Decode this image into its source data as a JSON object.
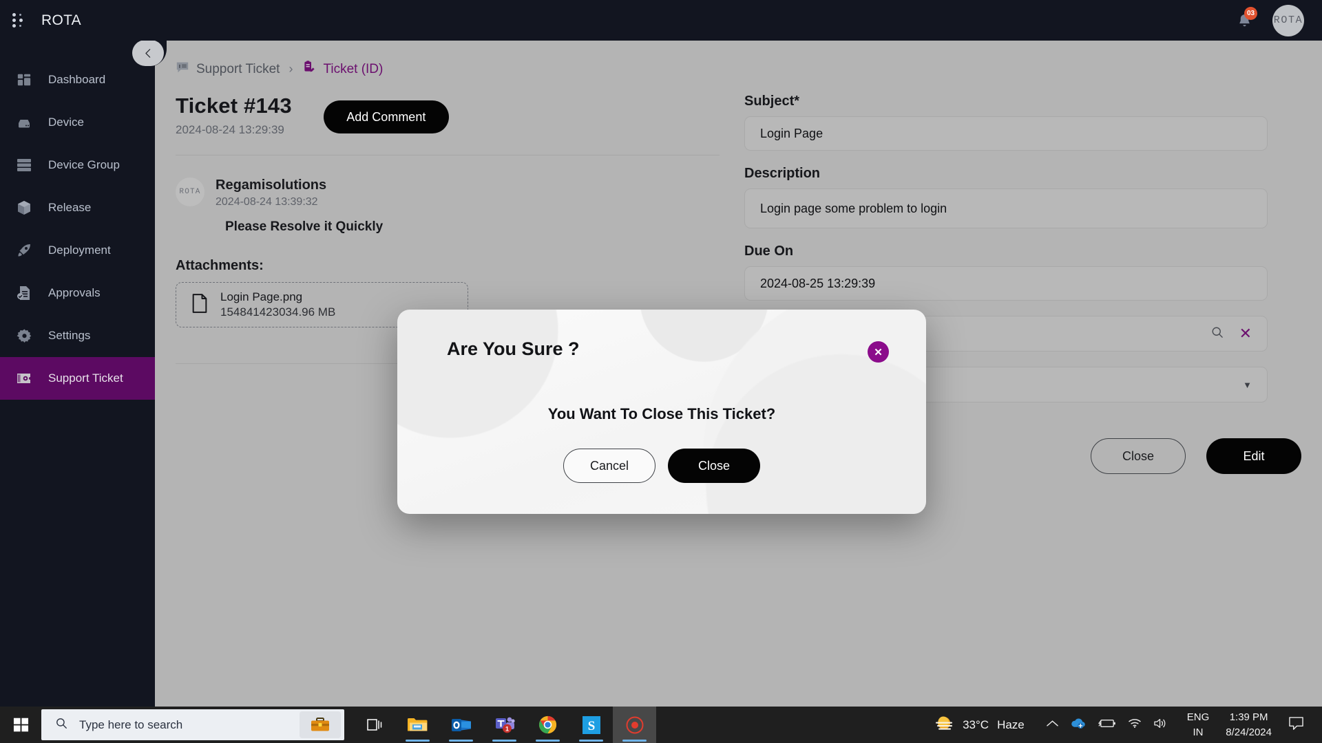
{
  "app": {
    "brand": "ROTA",
    "notification_count": "03",
    "avatar_initials": "ROTA"
  },
  "sidebar": {
    "items": [
      {
        "label": "Dashboard",
        "icon": "dashboard-icon",
        "active": false
      },
      {
        "label": "Device",
        "icon": "device-icon",
        "active": false
      },
      {
        "label": "Device Group",
        "icon": "device-group-icon",
        "active": false
      },
      {
        "label": "Release",
        "icon": "release-box-icon",
        "active": false
      },
      {
        "label": "Deployment",
        "icon": "rocket-icon",
        "active": false
      },
      {
        "label": "Approvals",
        "icon": "approvals-icon",
        "active": false
      },
      {
        "label": "Settings",
        "icon": "gear-icon",
        "active": false
      },
      {
        "label": "Support Ticket",
        "icon": "ticket-icon",
        "active": true
      }
    ],
    "active_color": "#5c0a62"
  },
  "breadcrumb": {
    "parent": "Support Ticket",
    "separator": "›",
    "current": "Ticket (ID)",
    "current_color": "#6b0f6e"
  },
  "ticket": {
    "title": "Ticket #143",
    "created_at": "2024-08-24 13:29:39",
    "add_comment_label": "Add Comment",
    "comment": {
      "avatar_initials": "ROTA",
      "author": "Regamisolutions",
      "timestamp": "2024-08-24 13:39:32",
      "body": "Please Resolve it Quickly"
    },
    "attachments_label": "Attachments:",
    "attachments": [
      {
        "name": "Login Page.png",
        "size": "154841423034.96 MB",
        "icon": "file-icon"
      }
    ]
  },
  "form": {
    "subject": {
      "label": "Subject*",
      "value": "Login Page"
    },
    "description": {
      "label": "Description",
      "value": "Login page some problem to login"
    },
    "due_on": {
      "label": "Due On",
      "value": "2024-08-25 13:29:39"
    },
    "search_field": {
      "value": "",
      "search_icon": "search-icon",
      "clear_icon": "clear-x-icon"
    },
    "select_field": {
      "value": "",
      "caret_icon": "chevron-down-icon"
    }
  },
  "footer": {
    "close_label": "Close",
    "edit_label": "Edit"
  },
  "modal": {
    "title": "Are You Sure ?",
    "message": "You Want To Close This Ticket?",
    "cancel_label": "Cancel",
    "confirm_label": "Close",
    "close_icon_glyph": "✕",
    "accent_color": "#8b0c8b"
  },
  "taskbar": {
    "start_icon": "windows-start-icon",
    "search": {
      "placeholder": "Type here to search",
      "icon": "search-icon",
      "chip_icon": "briefcase-icon"
    },
    "apps": [
      {
        "name": "task-view-icon",
        "running": false
      },
      {
        "name": "file-explorer-icon",
        "running": true
      },
      {
        "name": "outlook-icon",
        "running": true
      },
      {
        "name": "teams-icon",
        "running": true,
        "badge": "1"
      },
      {
        "name": "chrome-icon",
        "running": true
      },
      {
        "name": "snagit-icon",
        "running": true
      },
      {
        "name": "screen-recorder-icon",
        "running": true,
        "active": true
      }
    ],
    "weather": {
      "temperature": "33°C",
      "condition": "Haze",
      "icon": "haze-sun-icon"
    },
    "tray": {
      "chevron": "show-hidden-icons-icon",
      "icons": [
        "onedrive-icon",
        "battery-charging-icon",
        "wifi-icon",
        "volume-icon"
      ]
    },
    "language": {
      "line1": "ENG",
      "line2": "IN"
    },
    "clock": {
      "time": "1:39 PM",
      "date": "8/24/2024"
    },
    "notification_center": "notification-center-icon"
  }
}
